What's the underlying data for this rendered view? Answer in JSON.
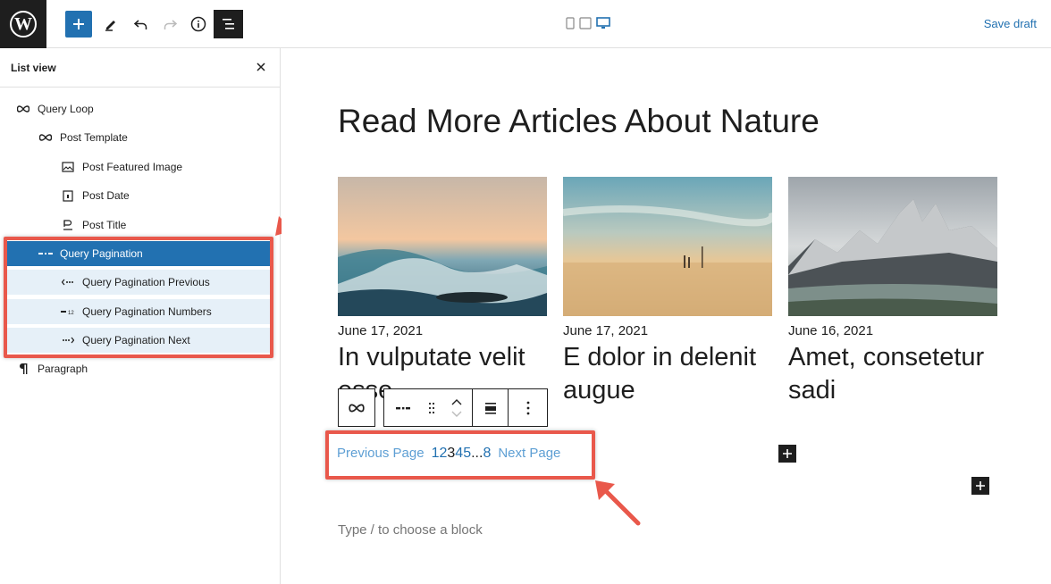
{
  "toolbar": {
    "save_draft_label": "Save draft",
    "add_icon": "plus-icon",
    "edit_icon": "pencil-icon",
    "undo_icon": "undo-icon",
    "redo_icon": "redo-icon",
    "info_icon": "info-icon",
    "list_icon": "list-view-icon",
    "preview_devices": [
      "mobile-icon",
      "tablet-icon",
      "desktop-icon"
    ],
    "accent": "#2271b1"
  },
  "list_view": {
    "title": "List view",
    "items": [
      {
        "label": "Query Loop",
        "icon": "loop-icon",
        "depth": 0,
        "state": "normal"
      },
      {
        "label": "Post Template",
        "icon": "loop-icon",
        "depth": 1,
        "state": "normal"
      },
      {
        "label": "Post Featured Image",
        "icon": "image-icon",
        "depth": 2,
        "state": "normal"
      },
      {
        "label": "Post Date",
        "icon": "calendar-icon",
        "depth": 2,
        "state": "normal"
      },
      {
        "label": "Post Title",
        "icon": "title-icon",
        "depth": 2,
        "state": "normal"
      },
      {
        "label": "Query Pagination",
        "icon": "pagination-icon",
        "depth": 1,
        "state": "selected"
      },
      {
        "label": "Query Pagination Previous",
        "icon": "pagination-previous-icon",
        "depth": 2,
        "state": "child"
      },
      {
        "label": "Query Pagination Numbers",
        "icon": "pagination-numbers-icon",
        "depth": 2,
        "state": "child"
      },
      {
        "label": "Query Pagination Next",
        "icon": "pagination-next-icon",
        "depth": 2,
        "state": "child"
      },
      {
        "label": "Paragraph",
        "icon": "paragraph-icon",
        "depth": 0,
        "state": "normal"
      }
    ]
  },
  "canvas": {
    "heading": "Read More Articles About Nature",
    "posts": [
      {
        "date": "June 17, 2021",
        "title": "In vulputate velit esse"
      },
      {
        "date": "June 17, 2021",
        "title": "E dolor in delenit augue"
      },
      {
        "date": "June 16, 2021",
        "title": "Amet, consetetur sadi"
      }
    ],
    "pagination": {
      "previous": "Previous Page",
      "numbers": [
        "1",
        "2",
        "3",
        "4",
        "5",
        "...",
        "8"
      ],
      "current": "3",
      "next": "Next Page"
    },
    "placeholder": "Type / to choose a block"
  },
  "colors": {
    "highlight": "#e9584b",
    "selected": "#2271b1",
    "link": "#5e9fd4"
  }
}
